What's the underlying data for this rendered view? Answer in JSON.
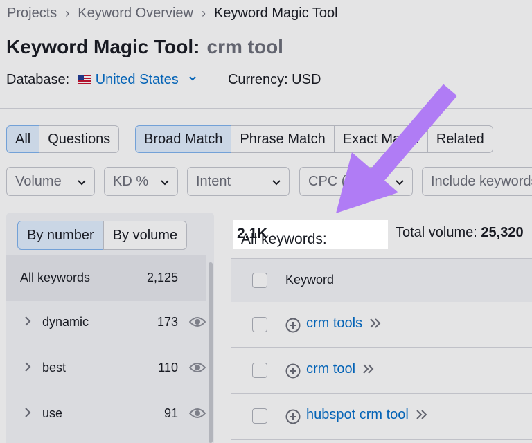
{
  "breadcrumb": [
    "Projects",
    "Keyword Overview",
    "Keyword Magic Tool"
  ],
  "page_title": {
    "label": "Keyword Magic Tool:",
    "query": "crm tool"
  },
  "database": {
    "label": "Database:",
    "value": "United States",
    "currency_label": "Currency: USD"
  },
  "match_tabs_left": [
    "All",
    "Questions"
  ],
  "match_tabs": [
    "Broad Match",
    "Phrase Match",
    "Exact Match",
    "Related"
  ],
  "filters": [
    "Volume",
    "KD %",
    "Intent",
    "CPC (USD)",
    "Include keywords"
  ],
  "group_toggle": [
    "By number",
    "By volume"
  ],
  "groups": {
    "all_label": "All keywords",
    "all_count": "2,125",
    "items": [
      {
        "label": "dynamic",
        "count": "173"
      },
      {
        "label": "best",
        "count": "110"
      },
      {
        "label": "use",
        "count": "91"
      }
    ]
  },
  "summary": {
    "kw_label": "All keywords:",
    "kw_value": "2.1K",
    "vol_label": "Total volume:",
    "vol_value": "25,320"
  },
  "table": {
    "header": "Keyword",
    "rows": [
      "crm tools",
      "crm tool",
      "hubspot crm tool"
    ]
  },
  "colors": {
    "accent": "#006dca",
    "arrow": "#b07cf5",
    "active_tab": "#e2efff"
  }
}
